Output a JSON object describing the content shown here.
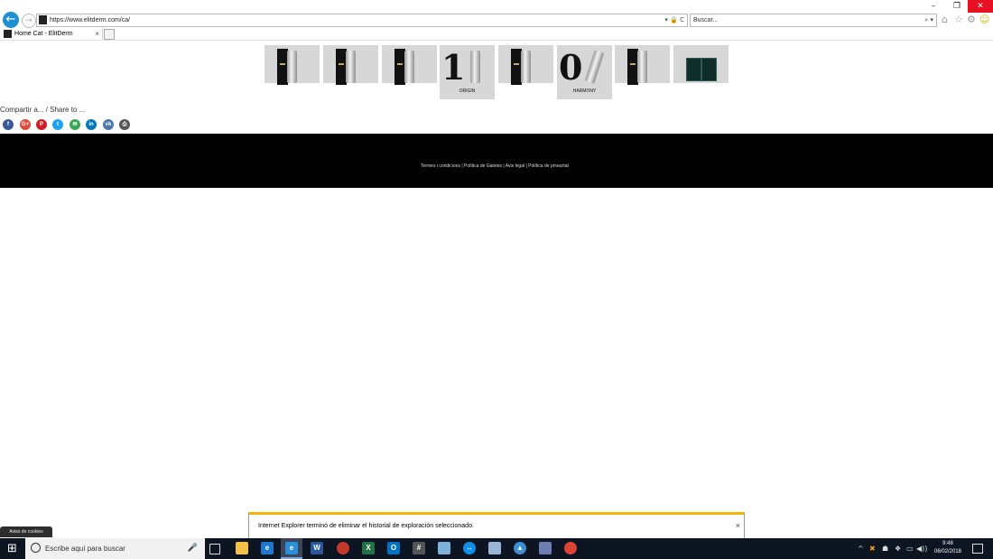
{
  "browser": {
    "back_glyph": "←",
    "forward_glyph": "→",
    "url": "https://www.elitderm.com/ca/",
    "url_tools": "▾ 🔒 C",
    "search_placeholder": "Buscar...",
    "search_tools": "⌕ ▾",
    "window_controls": [
      "–",
      "❐",
      "✕"
    ],
    "toolbar_icons": [
      "home-icon",
      "star-icon",
      "gear-icon",
      "smiley-icon"
    ],
    "tab": {
      "title": "Home Cat - ElitDerm",
      "close": "×"
    }
  },
  "products": [
    {
      "kind": "bottle-box"
    },
    {
      "kind": "bottle-box"
    },
    {
      "kind": "bottle-box"
    },
    {
      "kind": "origin",
      "number": "1",
      "label": "ORIGIN"
    },
    {
      "kind": "bottle-box"
    },
    {
      "kind": "harmony",
      "number": "0",
      "label": "HARMONY"
    },
    {
      "kind": "bottle-box"
    },
    {
      "kind": "kit"
    }
  ],
  "share": {
    "label": "Compartir a... / Share to ...",
    "icons": [
      {
        "name": "facebook-icon",
        "glyph": "f",
        "color": "#3b5998"
      },
      {
        "name": "google-plus-icon",
        "glyph": "G+",
        "color": "#dd4b39"
      },
      {
        "name": "pinterest-icon",
        "glyph": "P",
        "color": "#cb2027"
      },
      {
        "name": "twitter-icon",
        "glyph": "t",
        "color": "#1da1f2"
      },
      {
        "name": "email-icon",
        "glyph": "✉",
        "color": "#3aa757"
      },
      {
        "name": "linkedin-icon",
        "glyph": "in",
        "color": "#0077b5"
      },
      {
        "name": "vk-icon",
        "glyph": "vk",
        "color": "#4a76a8"
      },
      {
        "name": "print-icon",
        "glyph": "⎙",
        "color": "#555555"
      }
    ]
  },
  "footer": {
    "links_text": "Termes i condicions | Política de Galetes | Avis legal | Política de privacitat"
  },
  "notification": {
    "text": "Internet Explorer terminó de eliminar el historial de exploración seleccionado.",
    "close": "×"
  },
  "cookie_notice": "Aviso de cookies",
  "taskbar": {
    "start_glyph": "⊞",
    "search_placeholder": "Escribe aquí para buscar",
    "mic_glyph": "🎤",
    "apps": [
      {
        "name": "file-explorer-icon",
        "glyph": "",
        "color": "#f2c14a"
      },
      {
        "name": "edge-icon",
        "glyph": "e",
        "color": "#1e78d0"
      },
      {
        "name": "internet-explorer-icon",
        "glyph": "e",
        "color": "#2a8fd8",
        "active": true
      },
      {
        "name": "word-icon",
        "glyph": "W",
        "color": "#2b579a"
      },
      {
        "name": "red-app-icon",
        "glyph": "",
        "color": "#c0392b"
      },
      {
        "name": "excel-icon",
        "glyph": "X",
        "color": "#217346"
      },
      {
        "name": "outlook-icon",
        "glyph": "O",
        "color": "#0072c6"
      },
      {
        "name": "calculator-icon",
        "glyph": "#",
        "color": "#555555"
      },
      {
        "name": "notes-app-icon",
        "glyph": "",
        "color": "#7fb0d9"
      },
      {
        "name": "teamviewer-icon",
        "glyph": "↔",
        "color": "#0e8ee9"
      },
      {
        "name": "cube-app-icon",
        "glyph": "",
        "color": "#9ab6d6"
      },
      {
        "name": "triangle-app-icon",
        "glyph": "▲",
        "color": "#3d8fd6"
      },
      {
        "name": "remote-desktop-icon",
        "glyph": "",
        "color": "#6d7fb2"
      },
      {
        "name": "chrome-icon",
        "glyph": "",
        "color": "#db4437"
      }
    ],
    "tray": [
      "^",
      "✖",
      "☗",
      "❖",
      "▭",
      "◀))"
    ],
    "time": "9:48",
    "date": "06/02/2018"
  }
}
